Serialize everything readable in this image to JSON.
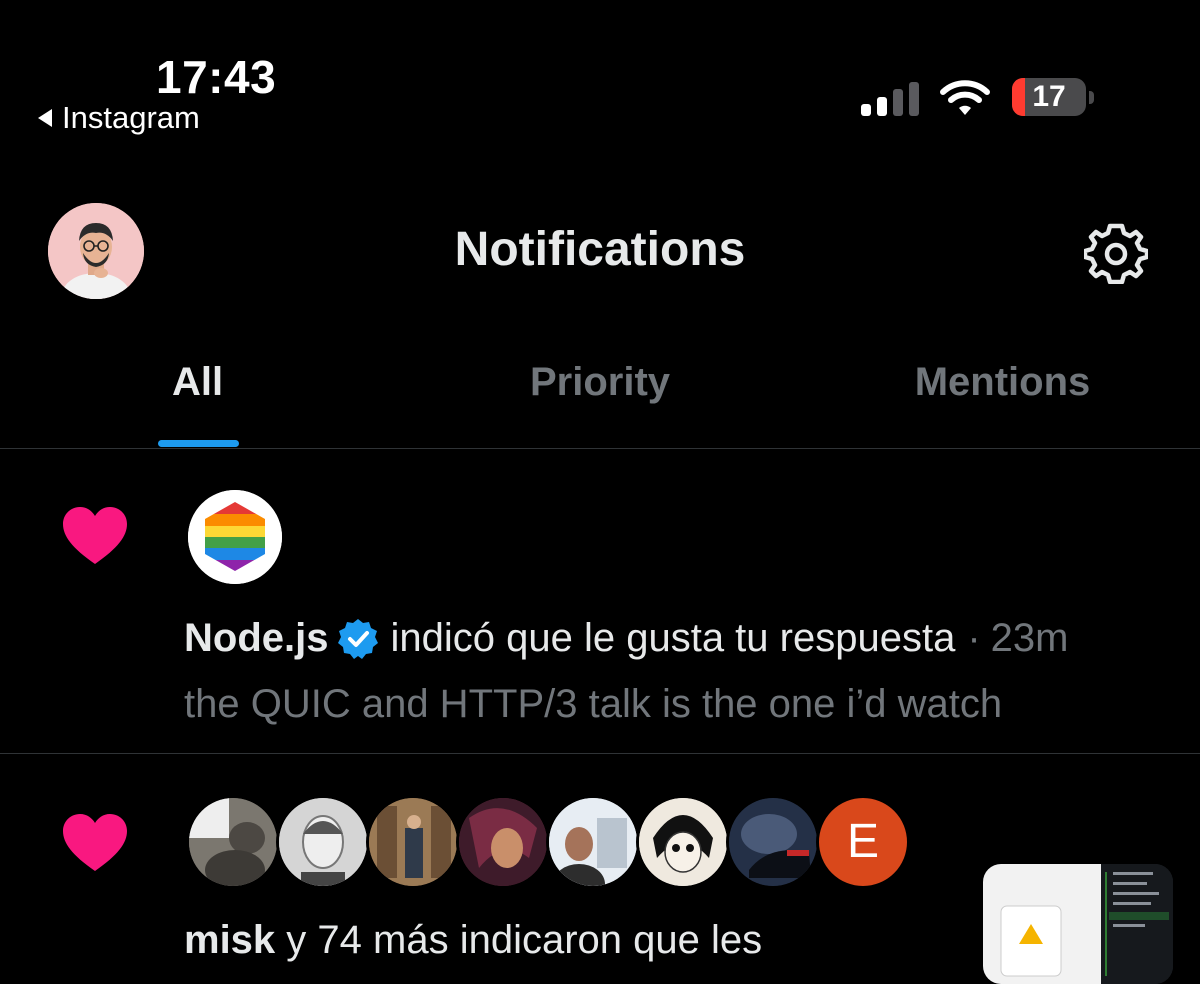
{
  "status_bar": {
    "time": "17:43",
    "back_app": "Instagram",
    "battery_level": "17",
    "battery_color": "#ff3b30"
  },
  "header": {
    "title": "Notifications",
    "settings_icon": "gear-icon"
  },
  "tabs": [
    {
      "label": "All",
      "active": true
    },
    {
      "label": "Priority",
      "active": false
    },
    {
      "label": "Mentions",
      "active": false
    }
  ],
  "accent_color": "#1d9bf0",
  "like_color": "#f91880",
  "notifications": [
    {
      "type": "like",
      "icon": "heart-icon",
      "actor": "Node.js",
      "verified": true,
      "action": "indicó que le gusta tu respuesta",
      "separator": "·",
      "time": "23m",
      "snippet": "the QUIC and HTTP/3 talk is the one i’d watch"
    },
    {
      "type": "like",
      "icon": "heart-icon",
      "avatar_initial": "E",
      "actor": "misk",
      "action": "y 74 más indicaron que les"
    }
  ]
}
